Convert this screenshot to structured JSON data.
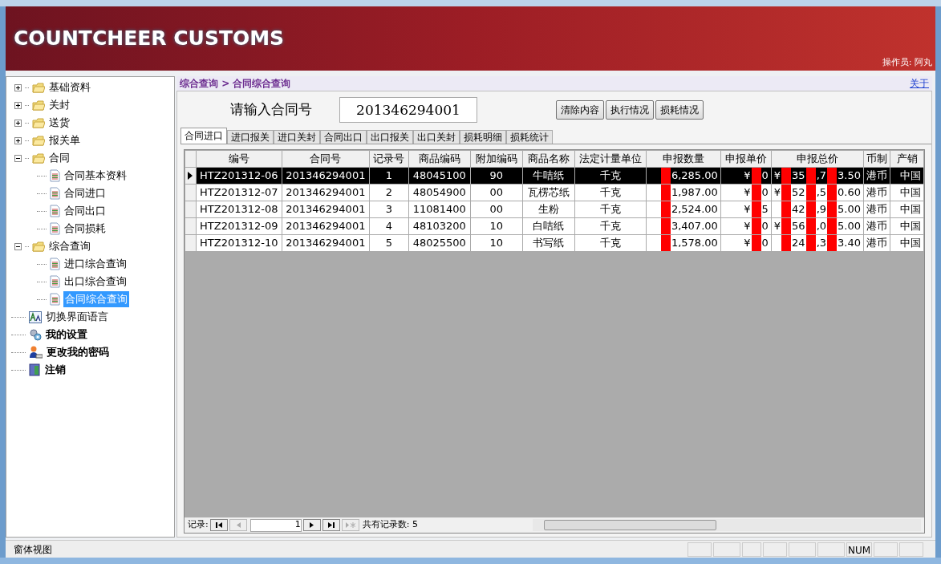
{
  "banner": {
    "title": "COUNTCHEER CUSTOMS",
    "operator": "操作员: 阿丸"
  },
  "sidebar": {
    "items": [
      {
        "label": "基础资料",
        "kind": "folder",
        "expanded": false,
        "selected": false
      },
      {
        "label": "关封",
        "kind": "folder",
        "expanded": false,
        "selected": false
      },
      {
        "label": "送货",
        "kind": "folder",
        "expanded": false,
        "selected": false
      },
      {
        "label": "报关单",
        "kind": "folder",
        "expanded": false,
        "selected": false
      },
      {
        "label": "合同",
        "kind": "folder",
        "expanded": true,
        "selected": false,
        "children": [
          {
            "label": "合同基本资料",
            "kind": "doc",
            "selected": false
          },
          {
            "label": "合同进口",
            "kind": "doc",
            "selected": false
          },
          {
            "label": "合同出口",
            "kind": "doc",
            "selected": false
          },
          {
            "label": "合同损耗",
            "kind": "doc",
            "selected": false
          }
        ]
      },
      {
        "label": "综合查询",
        "kind": "folder",
        "expanded": true,
        "selected": false,
        "children": [
          {
            "label": "进口综合查询",
            "kind": "doc",
            "selected": false
          },
          {
            "label": "出口综合查询",
            "kind": "doc",
            "selected": false
          },
          {
            "label": "合同综合查询",
            "kind": "doc",
            "selected": true
          }
        ]
      },
      {
        "label": "切换界面语言",
        "kind": "language",
        "selected": false
      },
      {
        "label": "我的设置",
        "kind": "settings",
        "selected": false
      },
      {
        "label": "更改我的密码",
        "kind": "password",
        "selected": false
      },
      {
        "label": "注销",
        "kind": "logout",
        "selected": false
      }
    ]
  },
  "breadcrumb": "综合查询 > 合同综合查询",
  "about_link": "关于",
  "search": {
    "label": "请输入合同号",
    "value": "201346294001"
  },
  "buttons": [
    "清除内容",
    "执行情况",
    "损耗情况"
  ],
  "tabs": [
    {
      "label": "合同进口",
      "selected": true
    },
    {
      "label": "进口报关",
      "selected": false
    },
    {
      "label": "进口关封",
      "selected": false
    },
    {
      "label": "合同出口",
      "selected": false
    },
    {
      "label": "出口报关",
      "selected": false
    },
    {
      "label": "出口关封",
      "selected": false
    },
    {
      "label": "损耗明细",
      "selected": false
    },
    {
      "label": "损耗统计",
      "selected": false
    }
  ],
  "table": {
    "columns": [
      "编号",
      "合同号",
      "记录号",
      "商品编码",
      "附加编码",
      "商品名称",
      "法定计量单位",
      "申报数量",
      "申报单价",
      "申报总价",
      "币制",
      "产销"
    ],
    "rows": [
      {
        "selected": true,
        "cells": [
          "HTZ201312-06",
          "201346294001",
          "1",
          "48045100",
          "90",
          "牛咭纸",
          "千克",
          [
            null,
            "6,285.00"
          ],
          [
            "¥",
            null,
            "0"
          ],
          [
            "¥",
            null,
            "35",
            null,
            ",7",
            null,
            "3.50"
          ],
          "港币",
          "中国"
        ]
      },
      {
        "selected": false,
        "cells": [
          "HTZ201312-07",
          "201346294001",
          "2",
          "48054900",
          "00",
          "瓦楞芯纸",
          "千克",
          [
            null,
            "1,987.00"
          ],
          [
            "¥",
            null,
            "0"
          ],
          [
            "¥",
            null,
            "52",
            null,
            ",5",
            null,
            "0.60"
          ],
          "港币",
          "中国"
        ]
      },
      {
        "selected": false,
        "cells": [
          "HTZ201312-08",
          "201346294001",
          "3",
          "11081400",
          "00",
          "生粉",
          "千克",
          [
            null,
            "2,524.00"
          ],
          [
            "¥",
            null,
            "5"
          ],
          [
            null,
            "42",
            null,
            ",9",
            null,
            "5.00"
          ],
          "港币",
          "中国"
        ]
      },
      {
        "selected": false,
        "cells": [
          "HTZ201312-09",
          "201346294001",
          "4",
          "48103200",
          "10",
          "白咭纸",
          "千克",
          [
            null,
            "3,407.00"
          ],
          [
            "¥",
            null,
            "0"
          ],
          [
            "¥",
            null,
            "56",
            null,
            ",0",
            null,
            "5.00"
          ],
          "港币",
          "中国"
        ]
      },
      {
        "selected": false,
        "cells": [
          "HTZ201312-10",
          "201346294001",
          "5",
          "48025500",
          "10",
          "书写纸",
          "千克",
          [
            null,
            "1,578.00"
          ],
          [
            "¥",
            null,
            "0"
          ],
          [
            null,
            "24",
            null,
            ",3",
            null,
            "3.40"
          ],
          "港币",
          "中国"
        ]
      }
    ]
  },
  "navigator": {
    "label": "记录:",
    "current": "1",
    "total": "共有记录数: 5"
  },
  "status_bar": {
    "text": "窗体视图",
    "indicator": "NUM"
  }
}
